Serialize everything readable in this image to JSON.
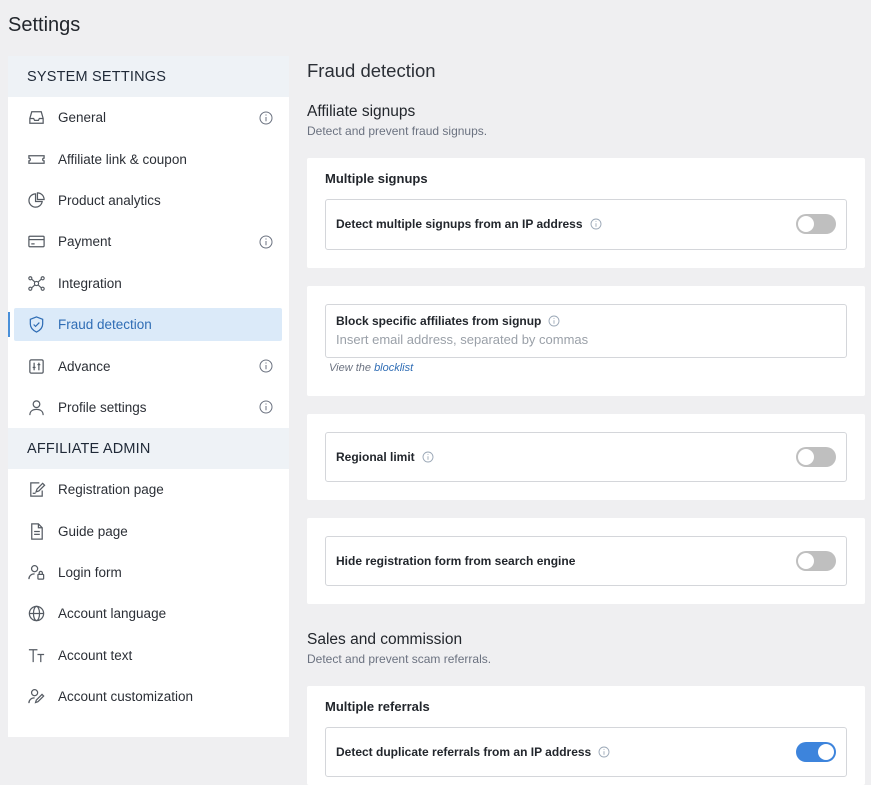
{
  "page_title": "Settings",
  "sidebar": {
    "system_header": "SYSTEM SETTINGS",
    "system_items": [
      {
        "label": "General",
        "icon": "inbox-icon",
        "info": true
      },
      {
        "label": "Affiliate link & coupon",
        "icon": "ticket-icon",
        "info": false
      },
      {
        "label": "Product analytics",
        "icon": "pie-chart-icon",
        "info": false
      },
      {
        "label": "Payment",
        "icon": "credit-card-icon",
        "info": true
      },
      {
        "label": "Integration",
        "icon": "network-icon",
        "info": false
      },
      {
        "label": "Fraud detection",
        "icon": "shield-check-icon",
        "info": false,
        "active": true
      },
      {
        "label": "Advance",
        "icon": "sliders-icon",
        "info": true
      },
      {
        "label": "Profile settings",
        "icon": "user-icon",
        "info": true
      }
    ],
    "admin_header": "AFFILIATE ADMIN",
    "admin_items": [
      {
        "label": "Registration page",
        "icon": "edit-form-icon"
      },
      {
        "label": "Guide page",
        "icon": "document-icon"
      },
      {
        "label": "Login form",
        "icon": "user-lock-icon"
      },
      {
        "label": "Account language",
        "icon": "globe-icon"
      },
      {
        "label": "Account text",
        "icon": "text-size-icon"
      },
      {
        "label": "Account customization",
        "icon": "user-pen-icon"
      }
    ]
  },
  "main": {
    "title": "Fraud detection",
    "signups": {
      "title": "Affiliate signups",
      "subtitle": "Detect and prevent fraud signups.",
      "multiple_signups": {
        "title": "Multiple signups",
        "label": "Detect multiple signups from an IP address",
        "enabled": false
      },
      "block_affiliates": {
        "label": "Block specific affiliates from signup",
        "placeholder": "Insert email address, separated by commas",
        "value": "",
        "note_prefix": "View the",
        "note_link": "blocklist"
      },
      "regional_limit": {
        "label": "Regional limit",
        "enabled": false
      },
      "hide_registration": {
        "label": "Hide registration form from search engine",
        "enabled": false
      }
    },
    "sales": {
      "title": "Sales and commission",
      "subtitle": "Detect and prevent scam referrals.",
      "multiple_referrals": {
        "title": "Multiple referrals",
        "label": "Detect duplicate referrals from an IP address",
        "enabled": true
      }
    }
  },
  "colors": {
    "accent": "#3d84dc",
    "active_bg": "#dbeaf9",
    "toggle_off": "#bfbfbf"
  }
}
